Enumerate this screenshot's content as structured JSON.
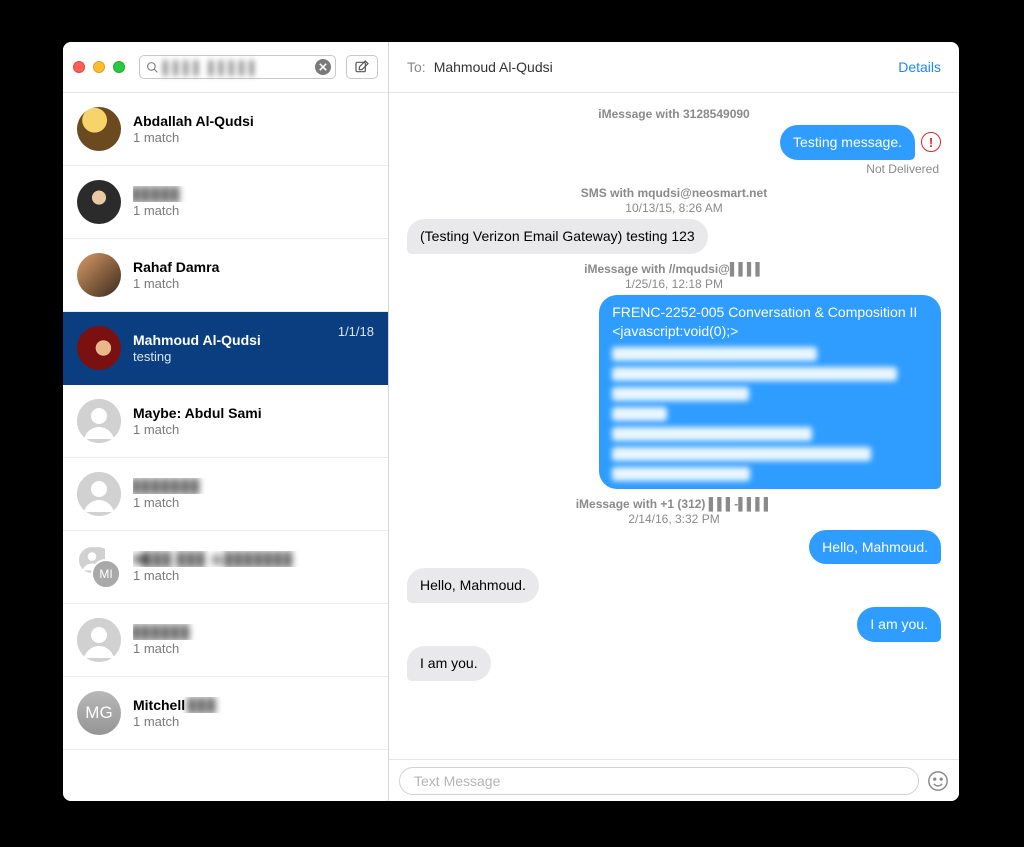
{
  "search": {
    "value": "▌▌▌▌ ▌▌▌▌▌"
  },
  "sidebar": [
    {
      "name": "Abdallah Al-Qudsi",
      "sub": "1 match",
      "avatar": "photo1"
    },
    {
      "name": "▌▌▌▌▌",
      "sub": "1 match",
      "avatar": "photo2",
      "blurred": true
    },
    {
      "name": "Rahaf Damra",
      "sub": "1 match",
      "avatar": "photo3"
    },
    {
      "name": "Mahmoud Al-Qudsi",
      "sub": "testing",
      "date": "1/1/18",
      "avatar": "photo4",
      "selected": true
    },
    {
      "name": "Maybe: Abdul Sami",
      "sub": "1 match",
      "avatar": "silhouette"
    },
    {
      "name": "▌▌▌▌▌▌▌",
      "sub": "1 match",
      "avatar": "silhouette",
      "blurred": true
    },
    {
      "name": "M▌▌▌ ▌▌▌ & ▌▌▌▌▌▌▌",
      "sub": "1 match",
      "avatar": "group2",
      "blurred": true,
      "badge": "MI"
    },
    {
      "name": "▌▌▌▌▌▌",
      "sub": "1 match",
      "avatar": "silhouette",
      "blurred": true
    },
    {
      "name": "Mitchell ▌▌▌",
      "sub": "1 match",
      "avatar": "initials",
      "initials": "MG",
      "blurred_tail": true
    }
  ],
  "header": {
    "to_label": "To:",
    "recipient": "Mahmoud Al-Qudsi",
    "details": "Details"
  },
  "thread": [
    {
      "type": "meta",
      "title": "iMessage with 3128549090"
    },
    {
      "type": "out",
      "text": "Testing message.",
      "failed": true,
      "status": "Not Delivered"
    },
    {
      "type": "meta",
      "title": "SMS with mqudsi@neosmart.net",
      "date": "10/13/15, 8:26 AM"
    },
    {
      "type": "in",
      "text": "(Testing Verizon Email Gateway) testing 123"
    },
    {
      "type": "meta",
      "title": "iMessage with //mqudsi@▌▌▌▌",
      "date": "1/25/16, 12:18 PM"
    },
    {
      "type": "out",
      "text": "FRENC-2252-005 Conversation & Composition II <javascript:void(0);>",
      "redacted_lines": 7
    },
    {
      "type": "meta",
      "title": "iMessage with +1 (312) ▌▌▌-▌▌▌▌",
      "date": "2/14/16, 3:32 PM"
    },
    {
      "type": "out",
      "text": "Hello, Mahmoud."
    },
    {
      "type": "in",
      "text": "Hello, Mahmoud."
    },
    {
      "type": "out",
      "text": "I am you."
    },
    {
      "type": "in",
      "text": "I am you."
    }
  ],
  "composer": {
    "placeholder": "Text Message"
  }
}
